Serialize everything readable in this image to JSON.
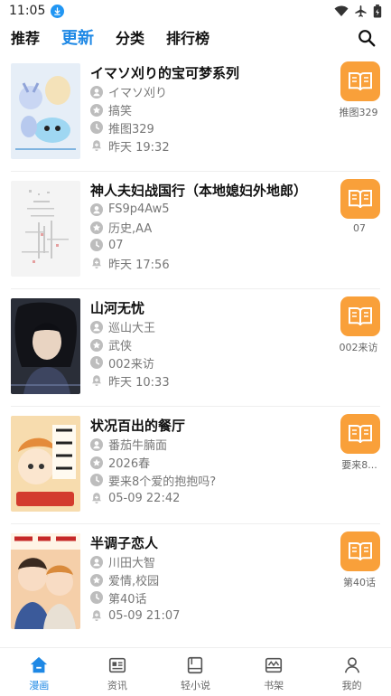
{
  "status": {
    "time": "11:05"
  },
  "tabs": [
    {
      "label": "推荐"
    },
    {
      "label": "更新"
    },
    {
      "label": "分类"
    },
    {
      "label": "排行榜"
    }
  ],
  "items": [
    {
      "title": "イマソ刈り的宝可梦系列",
      "author": "イマソ刈り",
      "genre": "搞笑",
      "latest": "推图329",
      "updated": "昨天 19:32",
      "chapter_badge": "推图329",
      "cover_bg": "#dfeaf5"
    },
    {
      "title": "神人夫妇战国行（本地媳妇外地郎）",
      "author": "FS9p4Aw5",
      "genre": "历史,AA",
      "latest": "07",
      "updated": "昨天 17:56",
      "chapter_badge": "07",
      "cover_bg": "#f3f3f3"
    },
    {
      "title": "山河无忧",
      "author": "巡山大王",
      "genre": "武侠",
      "latest": "002来访",
      "updated": "昨天 10:33",
      "chapter_badge": "002来访",
      "cover_bg": "#2b2f3a"
    },
    {
      "title": "状况百出的餐厅",
      "author": "番茄牛腩面",
      "genre": "2026春",
      "latest": "要来8个爱的抱抱吗?",
      "updated": "05-09 22:42",
      "chapter_badge": "要来8...",
      "cover_bg": "#f6d9a8"
    },
    {
      "title": "半调子恋人",
      "author": "川田大智",
      "genre": "爱情,校园",
      "latest": "第40话",
      "updated": "05-09 21:07",
      "chapter_badge": "第40话",
      "cover_bg": "#f2c9a4"
    }
  ],
  "bottom_nav": [
    {
      "label": "漫画"
    },
    {
      "label": "资讯"
    },
    {
      "label": "轻小说"
    },
    {
      "label": "书架"
    },
    {
      "label": "我的"
    }
  ],
  "colors": {
    "accent": "#1e88e5",
    "read_button": "#f9a03a"
  }
}
